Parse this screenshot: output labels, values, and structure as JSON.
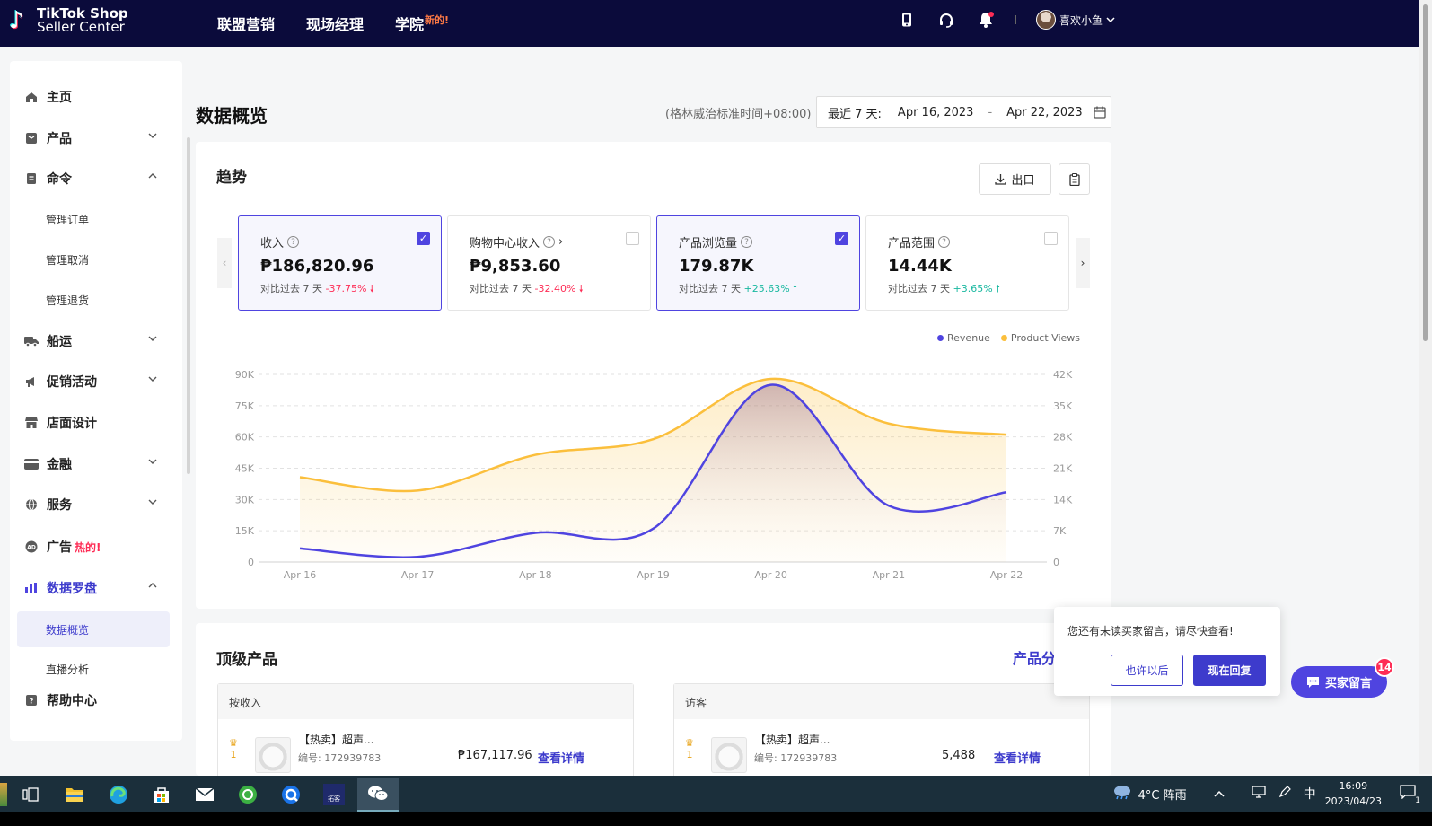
{
  "header": {
    "logo_line1": "TikTok Shop",
    "logo_line2": "Seller Center",
    "nav": [
      {
        "label": "联盟营销"
      },
      {
        "label": "现场经理"
      },
      {
        "label": "学院",
        "badge": "新的!"
      }
    ],
    "user_name": "喜欢小鱼"
  },
  "sidebar": {
    "items": [
      {
        "label": "主页",
        "icon": "home-icon"
      },
      {
        "label": "产品",
        "icon": "product-icon"
      },
      {
        "label": "命令",
        "icon": "order-icon"
      },
      {
        "label": "管理订单"
      },
      {
        "label": "管理取消"
      },
      {
        "label": "管理退货"
      },
      {
        "label": "船运",
        "icon": "truck-icon"
      },
      {
        "label": "促销活动",
        "icon": "megaphone-icon"
      },
      {
        "label": "店面设计",
        "icon": "store-icon"
      },
      {
        "label": "金融",
        "icon": "card-icon"
      },
      {
        "label": "服务",
        "icon": "globe-icon"
      },
      {
        "label": "广告",
        "icon": "ad-icon",
        "badge": "热的!"
      },
      {
        "label": "数据罗盘",
        "icon": "bar-chart-icon"
      },
      {
        "label": "数据概览"
      },
      {
        "label": "直播分析"
      },
      {
        "label": "帮助中心",
        "icon": "help-icon"
      }
    ]
  },
  "main": {
    "title": "数据概览",
    "timezone": "(格林威治标准时间+08:00)",
    "date_range": {
      "label": "最近 7 天:",
      "start": "Apr 16, 2023",
      "separator": "-",
      "end": "Apr 22, 2023"
    },
    "trend": {
      "title": "趋势",
      "export_label": "出口",
      "metrics": [
        {
          "label": "收入",
          "value": "₱186,820.96",
          "compare": "对比过去 7 天",
          "change": "-37.75%",
          "direction": "down",
          "selected": true
        },
        {
          "label": "购物中心收入",
          "value": "₱9,853.60",
          "compare": "对比过去 7 天",
          "change": "-32.40%",
          "direction": "down",
          "selected": false
        },
        {
          "label": "产品浏览量",
          "value": "179.87K",
          "compare": "对比过去 7 天",
          "change": "+25.63%",
          "direction": "up",
          "selected": true
        },
        {
          "label": "产品范围",
          "value": "14.44K",
          "compare": "对比过去 7 天",
          "change": "+3.65%",
          "direction": "up",
          "selected": false
        }
      ]
    },
    "top_products": {
      "title": "顶级产品",
      "link": "产品分",
      "panels": [
        {
          "header": "按收入",
          "rank": "1",
          "name": "【热卖】超声...",
          "id": "编号:  172939783",
          "value": "₱167,117.96",
          "action": "查看详情"
        },
        {
          "header": "访客",
          "rank": "1",
          "name": "【热卖】超声...",
          "id": "编号:  172939783",
          "value": "5,488",
          "action": "查看详情"
        }
      ]
    }
  },
  "chart_data": {
    "type": "line",
    "x": [
      "Apr 16",
      "Apr 17",
      "Apr 18",
      "Apr 19",
      "Apr 20",
      "Apr 21",
      "Apr 22"
    ],
    "series": [
      {
        "name": "Revenue",
        "axis": "left",
        "color": "#4f44e0",
        "values": [
          6500,
          2500,
          14000,
          16000,
          85000,
          27000,
          33500
        ]
      },
      {
        "name": "Product Views",
        "axis": "right",
        "color": "#fbbf3c",
        "values": [
          19000,
          16000,
          24000,
          27500,
          41000,
          31000,
          28500
        ]
      }
    ],
    "y_left": {
      "ticks": [
        "90K",
        "75K",
        "60K",
        "45K",
        "30K",
        "15K",
        "0"
      ],
      "range": [
        0,
        90000
      ]
    },
    "y_right": {
      "ticks": [
        "42K",
        "35K",
        "28K",
        "21K",
        "14K",
        "7K",
        "0"
      ],
      "range": [
        0,
        42000
      ]
    },
    "legend_position": "top-right",
    "grid": true
  },
  "popup": {
    "text": "您还有未读买家留言，请尽快查看!",
    "later_label": "也许以后",
    "reply_label": "现在回复"
  },
  "chat_button": {
    "label": "买家留言",
    "badge": "14"
  },
  "taskbar": {
    "weather": "4°C  阵雨",
    "ime": "中",
    "time": "16:09",
    "date": "2023/04/23",
    "notification_count": "1",
    "app_label": "拓客"
  }
}
